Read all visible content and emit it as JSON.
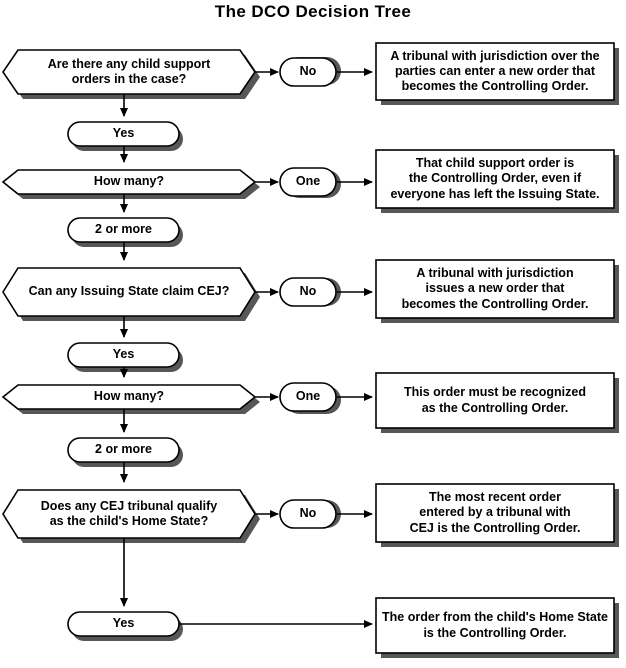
{
  "title": "The DCO Decision Tree",
  "colors": {
    "stroke": "#000000",
    "fill": "#ffffff",
    "shadow": "#575757",
    "text": "#000000",
    "background": "#ffffff"
  },
  "chart_data": {
    "type": "diagram",
    "diagram_kind": "flowchart",
    "title": "The DCO Decision Tree",
    "orientation": "top-to-bottom with right branches",
    "decisions": [
      {
        "id": "d1",
        "shape": "hexagon",
        "text": "Are there any child support\norders in the case?",
        "branches": [
          {
            "label": "No",
            "target": "r1"
          },
          {
            "label": "Yes",
            "target": "d2"
          }
        ]
      },
      {
        "id": "d2",
        "shape": "hexagon",
        "text": "How many?",
        "branches": [
          {
            "label": "One",
            "target": "r2"
          },
          {
            "label": "2 or more",
            "target": "d3"
          }
        ]
      },
      {
        "id": "d3",
        "shape": "hexagon",
        "text": "Can any Issuing State claim CEJ?",
        "branches": [
          {
            "label": "No",
            "target": "r3"
          },
          {
            "label": "Yes",
            "target": "d4"
          }
        ]
      },
      {
        "id": "d4",
        "shape": "hexagon",
        "text": "How many?",
        "branches": [
          {
            "label": "One",
            "target": "r4"
          },
          {
            "label": "2 or more",
            "target": "d5"
          }
        ]
      },
      {
        "id": "d5",
        "shape": "hexagon",
        "text": "Does any CEJ tribunal qualify\nas the child's Home State?",
        "branches": [
          {
            "label": "No",
            "target": "r5"
          },
          {
            "label": "Yes",
            "target": "r6"
          }
        ]
      }
    ],
    "results": [
      {
        "id": "r1",
        "shape": "rectangle",
        "text": "A tribunal with jurisdiction over the\nparties can enter a new order that\nbecomes the Controlling Order."
      },
      {
        "id": "r2",
        "shape": "rectangle",
        "text": "That child support order is\nthe Controlling Order, even if\neveryone has left the Issuing State."
      },
      {
        "id": "r3",
        "shape": "rectangle",
        "text": "A tribunal with jurisdiction\nissues a new order that\nbecomes the Controlling Order."
      },
      {
        "id": "r4",
        "shape": "rectangle",
        "text": "This order must be recognized\nas the Controlling Order."
      },
      {
        "id": "r5",
        "shape": "rectangle",
        "text": "The most recent order\nentered by a tribunal with\nCEJ is the Controlling Order."
      },
      {
        "id": "r6",
        "shape": "rectangle",
        "text": "The order from the child's Home State\nis the Controlling Order."
      }
    ]
  },
  "nodes": {
    "decision1": {
      "text": "Are there any child support\norders in the case?"
    },
    "decision2": {
      "text": "How many?"
    },
    "decision3": {
      "text": "Can any Issuing State claim CEJ?"
    },
    "decision4": {
      "text": "How many?"
    },
    "decision5": {
      "text": "Does any CEJ tribunal qualify\nas the child's Home State?"
    },
    "branch_no_1": {
      "text": "No"
    },
    "branch_yes_1": {
      "text": "Yes"
    },
    "branch_one_1": {
      "text": "One"
    },
    "branch_two_or_more_1": {
      "text": "2 or more"
    },
    "branch_no_2": {
      "text": "No"
    },
    "branch_yes_2": {
      "text": "Yes"
    },
    "branch_one_2": {
      "text": "One"
    },
    "branch_two_or_more_2": {
      "text": "2 or more"
    },
    "branch_no_3": {
      "text": "No"
    },
    "branch_yes_3": {
      "text": "Yes"
    },
    "result1": {
      "text": "A tribunal with jurisdiction over the\nparties can enter a new order that\nbecomes the Controlling Order."
    },
    "result2": {
      "text": "That child support order is\nthe Controlling Order, even if\neveryone has left the Issuing State."
    },
    "result3": {
      "text": "A tribunal with jurisdiction\nissues a new order that\nbecomes the Controlling Order."
    },
    "result4": {
      "text": "This order must be recognized\nas the Controlling Order."
    },
    "result5": {
      "text": "The most recent order\nentered by a tribunal with\nCEJ is the Controlling Order."
    },
    "result6": {
      "text": "The order from the child's Home State\nis the Controlling Order."
    }
  }
}
